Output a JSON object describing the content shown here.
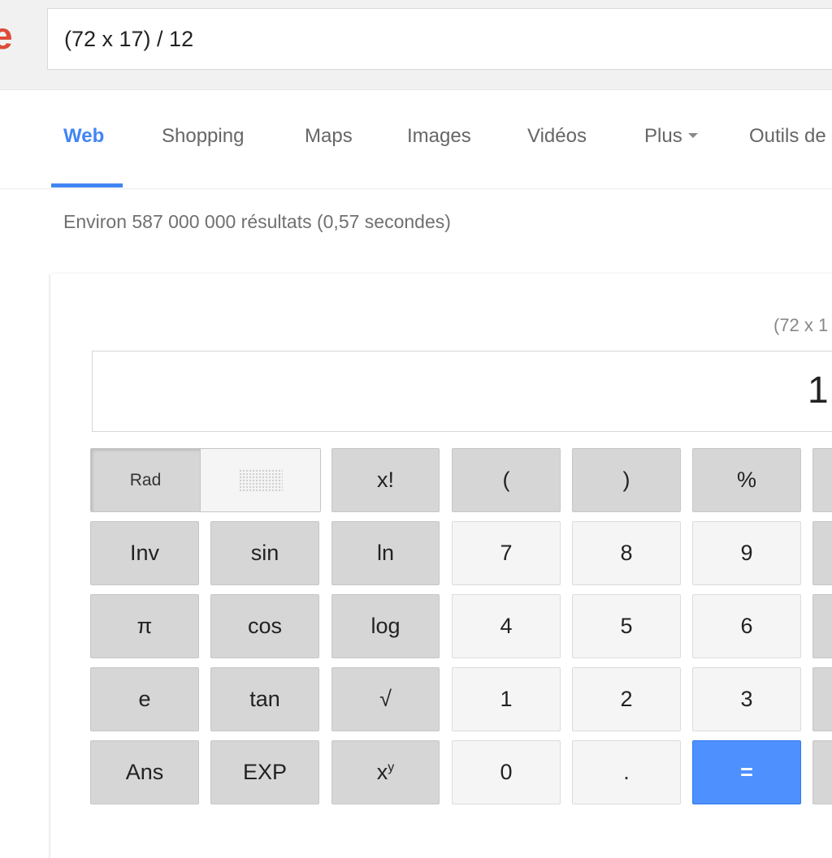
{
  "logo": {
    "letter": "e"
  },
  "search": {
    "query": "(72 x 17) / 12"
  },
  "tabs": [
    {
      "label": "Web",
      "active": true
    },
    {
      "label": "Shopping"
    },
    {
      "label": "Maps"
    },
    {
      "label": "Images"
    },
    {
      "label": "Vidéos"
    },
    {
      "label": "Plus",
      "icon": "caret-down-icon"
    },
    {
      "label": "Outils de"
    }
  ],
  "result_stats": "Environ 587 000 000 résultats (0,57 secondes)",
  "calculator": {
    "history": "(72 x 1",
    "result": "1",
    "angle_mode": {
      "rad_label": "Rad",
      "deg_icon": "dots-pattern-icon"
    },
    "keys": [
      [
        "x!",
        "(",
        ")",
        "%"
      ],
      [
        "Inv",
        "sin",
        "ln",
        "7",
        "8",
        "9"
      ],
      [
        "π",
        "cos",
        "log",
        "4",
        "5",
        "6"
      ],
      [
        "e",
        "tan",
        "√",
        "1",
        "2",
        "3"
      ],
      [
        "Ans",
        "EXP",
        "x",
        "0",
        ".",
        "="
      ]
    ],
    "xy_superscript": "y",
    "accent_color": "#4d90fe"
  },
  "colors": {
    "tab_active": "#4285f4",
    "logo": "#dd4b39"
  }
}
